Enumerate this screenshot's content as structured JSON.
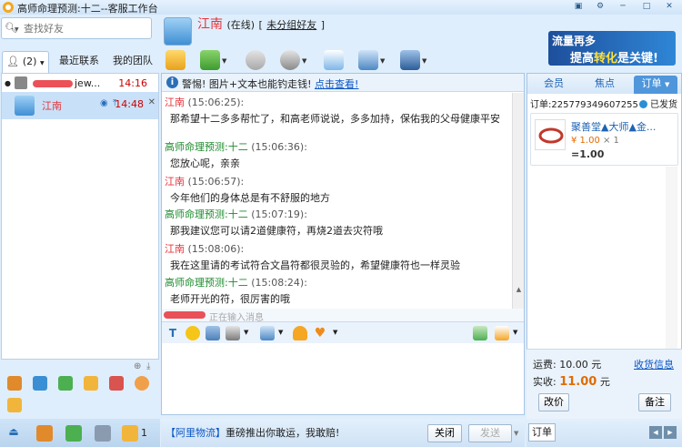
{
  "window": {
    "title": "高师命理预测:十二--客服工作台",
    "controls": [
      "▣",
      "⚙",
      "─",
      "□",
      "✕"
    ]
  },
  "search": {
    "placeholder": "查找好友"
  },
  "left_tabs": [
    {
      "label": "(2)",
      "active": true
    },
    {
      "label": "最近联系",
      "active": false
    },
    {
      "label": "我的团队",
      "active": false
    }
  ],
  "contacts": [
    {
      "name": "jew...",
      "time": "14:16"
    },
    {
      "name": "江南",
      "time": "14:48"
    }
  ],
  "header": {
    "contact_name": "江南",
    "status": "(在线)",
    "group_prefix": "[",
    "group_link": "未分组好友",
    "group_suffix": "]"
  },
  "ad": {
    "line1": "流量再多",
    "line2_a": "提高",
    "line2_b": "转化",
    "line2_c": "是关键!"
  },
  "warning": {
    "text": "警惕! 图片+文本也能钓走钱!",
    "link": "点击查看!"
  },
  "messages": [
    {
      "sender": "江南",
      "sender_color": "red",
      "time": "(15:06:25):",
      "text": "那希望十二多多帮忙了，和高老师说说，多多加持，保佑我的父母健康平安"
    },
    {
      "sender": "高师命理预测:十二",
      "sender_color": "green",
      "time": "(15:06:36):",
      "text": "您放心呢，亲亲"
    },
    {
      "sender": "江南",
      "sender_color": "red",
      "time": "(15:06:57):",
      "text": "今年他们的身体总是有不舒服的地方"
    },
    {
      "sender": "高师命理预测:十二",
      "sender_color": "green",
      "time": "(15:07:19):",
      "text": "那我建议您可以请2道健康符，再烧2道去灾符哦"
    },
    {
      "sender": "江南",
      "sender_color": "red",
      "time": "(15:08:06):",
      "text": "我在这里请的考试符合文昌符都很灵验的，希望健康符也一样灵验"
    },
    {
      "sender": "高师命理预测:十二",
      "sender_color": "green",
      "time": "(15:08:24):",
      "text": "老师开光的符，很厉害的哦"
    }
  ],
  "typing": "正在输入消息",
  "bottom_notice": {
    "tag": "【阿里物流】",
    "text": "重磅推出你敢运，我敢赔!"
  },
  "buttons": {
    "close": "关闭",
    "send": "发送"
  },
  "right_tabs": [
    {
      "label": "会员",
      "active": false
    },
    {
      "label": "焦点",
      "active": false
    },
    {
      "label": "订单",
      "active": true
    }
  ],
  "order": {
    "number": "订单:225779349607255",
    "status": "已发货",
    "item_name": "聚善堂▲大师▲金...",
    "price": "¥ 1.00",
    "qty": "× 1",
    "total": "=1.00",
    "shipping_label": "运费:",
    "shipping_value": "10.00",
    "shipping_unit": "元",
    "modify_link": "收货信息",
    "paid_label": "实收:",
    "paid_value": "11.00",
    "paid_unit": "元",
    "change_price": "改价",
    "remark": "备注"
  },
  "right_bottom_tab": "订单",
  "colors": {
    "accent": "#4f96db",
    "sender_green": "#1c8a2c",
    "price_orange": "#e26b00"
  }
}
